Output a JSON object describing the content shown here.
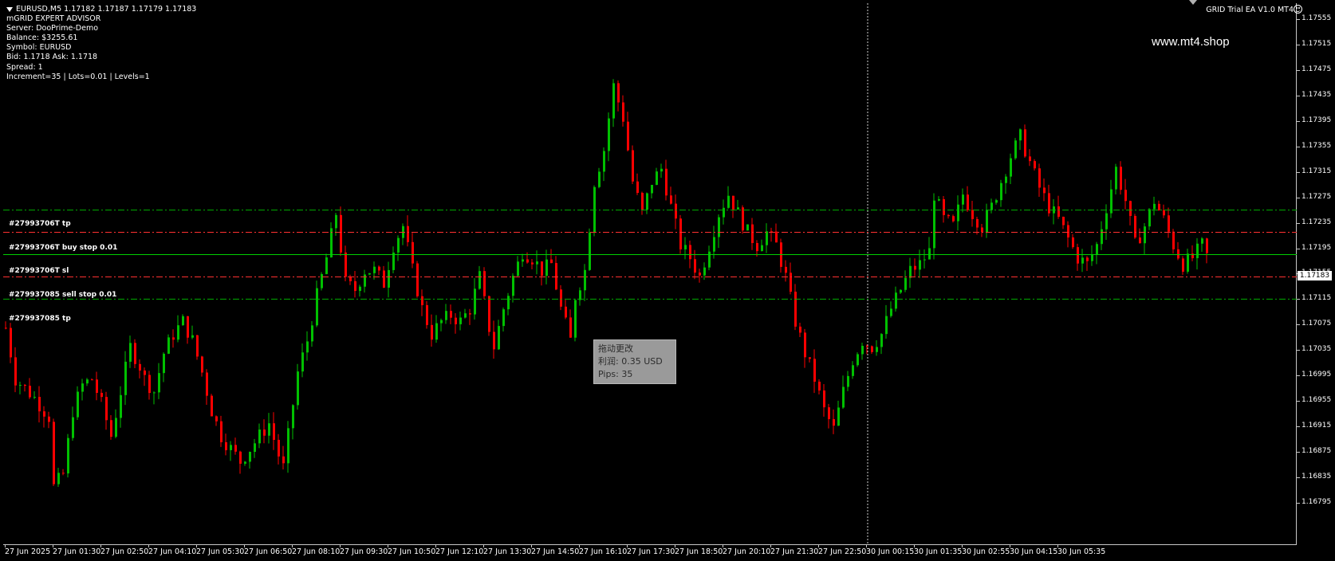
{
  "chart_header": {
    "symbol_line": "EURUSD,M5  1.17182 1.17187 1.17179 1.17183",
    "info_lines": [
      "mGRID EXPERT ADVISOR",
      "Server: DooPrime-Demo",
      "Balance: $3255.61",
      "Symbol: EURUSD",
      "Bid: 1.1718 Ask: 1.1718",
      "Spread: 1",
      "Increment=35 | Lots=0.01 | Levels=1"
    ]
  },
  "ea_title": "GRID Trial EA  V1.0 MT4",
  "icons": {
    "smiley": "smiley-face-icon",
    "dropdown": "dropdown-triangle-icon"
  },
  "watermark": "www.mt4.shop",
  "current_price": "1.17183",
  "order_lines": [
    {
      "label": "#27993706T  tp",
      "price": 1.17255,
      "color": "#00b000",
      "style": "dashdot"
    },
    {
      "label": "#27993706T  buy stop 0.01",
      "price": 1.1722,
      "color": "#ff3030",
      "style": "dashdot"
    },
    {
      "label": "#27993706T  sl",
      "price": 1.17185,
      "color": "#00d000",
      "style": "solid"
    },
    {
      "label": "#279937085  sell stop 0.01",
      "price": 1.1715,
      "color": "#ff3030",
      "style": "dashdot"
    },
    {
      "label": "#279937085  tp",
      "price": 1.17115,
      "color": "#00b000",
      "style": "dashdot"
    }
  ],
  "tooltip": {
    "title": "拖动更改",
    "profit": "利润:   0.35 USD",
    "pips": "Pips:  35"
  },
  "colors": {
    "background": "#000000",
    "bull_candle": "#00c000",
    "bear_candle": "#ff0000",
    "buy_line": "#ff3030",
    "tp_line": "#00b000",
    "sl_line": "#00d000"
  },
  "chart_data": {
    "type": "candlestick",
    "symbol": "EURUSD",
    "timeframe": "M5",
    "y_ticks": [
      "1.17555",
      "1.17515",
      "1.17475",
      "1.17435",
      "1.17395",
      "1.17355",
      "1.17315",
      "1.17275",
      "1.17235",
      "1.17195",
      "1.17155",
      "1.17115",
      "1.17075",
      "1.17035",
      "1.16995",
      "1.16955",
      "1.16915",
      "1.16875",
      "1.16835",
      "1.16795"
    ],
    "ylim": [
      1.16795,
      1.17555
    ],
    "x_ticks": [
      "27 Jun 2025",
      "27 Jun 01:30",
      "27 Jun 02:50",
      "27 Jun 04:10",
      "27 Jun 05:30",
      "27 Jun 06:50",
      "27 Jun 08:10",
      "27 Jun 09:30",
      "27 Jun 10:50",
      "27 Jun 12:10",
      "27 Jun 13:30",
      "27 Jun 14:50",
      "27 Jun 16:10",
      "27 Jun 17:30",
      "27 Jun 18:50",
      "27 Jun 20:10",
      "27 Jun 21:30",
      "27 Jun 22:50",
      "30 Jun 00:15",
      "30 Jun 01:35",
      "30 Jun 02:55",
      "30 Jun 04:15",
      "30 Jun 05:35"
    ],
    "period_separator_after": "27 Jun 22:50",
    "price_path": [
      [
        0,
        1.1707
      ],
      [
        2,
        1.1699
      ],
      [
        6,
        1.1696
      ],
      [
        9,
        1.1693
      ],
      [
        10,
        1.1682
      ],
      [
        12,
        1.1684
      ],
      [
        14,
        1.1694
      ],
      [
        16,
        1.1698
      ],
      [
        18,
        1.1699
      ],
      [
        20,
        1.1695
      ],
      [
        22,
        1.169
      ],
      [
        24,
        1.1697
      ],
      [
        26,
        1.1704
      ],
      [
        28,
        1.1701
      ],
      [
        29,
        1.1699
      ],
      [
        31,
        1.1697
      ],
      [
        33,
        1.1703
      ],
      [
        35,
        1.1706
      ],
      [
        37,
        1.1708
      ],
      [
        39,
        1.1705
      ],
      [
        41,
        1.17
      ],
      [
        43,
        1.1694
      ],
      [
        45,
        1.169
      ],
      [
        47,
        1.1688
      ],
      [
        49,
        1.1686
      ],
      [
        51,
        1.1688
      ],
      [
        53,
        1.169
      ],
      [
        55,
        1.1692
      ],
      [
        57,
        1.1687
      ],
      [
        58,
        1.1685
      ],
      [
        59,
        1.169
      ],
      [
        61,
        1.17
      ],
      [
        63,
        1.1705
      ],
      [
        65,
        1.1712
      ],
      [
        67,
        1.1718
      ],
      [
        69,
        1.1725
      ],
      [
        71,
        1.1714
      ],
      [
        73,
        1.1713
      ],
      [
        75,
        1.1716
      ],
      [
        77,
        1.1716
      ],
      [
        79,
        1.1714
      ],
      [
        81,
        1.172
      ],
      [
        83,
        1.1723
      ],
      [
        85,
        1.1716
      ],
      [
        87,
        1.171
      ],
      [
        89,
        1.1706
      ],
      [
        91,
        1.1708
      ],
      [
        93,
        1.1709
      ],
      [
        95,
        1.1708
      ],
      [
        97,
        1.171
      ],
      [
        99,
        1.1715
      ],
      [
        101,
        1.1707
      ],
      [
        102,
        1.1704
      ],
      [
        104,
        1.171
      ],
      [
        106,
        1.1715
      ],
      [
        108,
        1.1719
      ],
      [
        110,
        1.1718
      ],
      [
        112,
        1.1716
      ],
      [
        114,
        1.1717
      ],
      [
        116,
        1.171
      ],
      [
        118,
        1.1705
      ],
      [
        119,
        1.1712
      ],
      [
        121,
        1.1716
      ],
      [
        123,
        1.173
      ],
      [
        125,
        1.1735
      ],
      [
        127,
        1.1745
      ],
      [
        129,
        1.174
      ],
      [
        131,
        1.173
      ],
      [
        133,
        1.1725
      ],
      [
        135,
        1.173
      ],
      [
        137,
        1.1732
      ],
      [
        139,
        1.1726
      ],
      [
        141,
        1.172
      ],
      [
        143,
        1.1718
      ],
      [
        145,
        1.1715
      ],
      [
        147,
        1.172
      ],
      [
        149,
        1.1725
      ],
      [
        151,
        1.1728
      ],
      [
        153,
        1.1725
      ],
      [
        155,
        1.1722
      ],
      [
        157,
        1.172
      ],
      [
        159,
        1.1722
      ],
      [
        161,
        1.172
      ],
      [
        163,
        1.1715
      ],
      [
        165,
        1.1708
      ],
      [
        167,
        1.1703
      ],
      [
        169,
        1.1699
      ],
      [
        171,
        1.1694
      ],
      [
        173,
        1.1691
      ],
      [
        175,
        1.1697
      ],
      [
        177,
        1.1702
      ],
      [
        179,
        1.1705
      ],
      [
        181,
        1.1704
      ],
      [
        183,
        1.1706
      ],
      [
        185,
        1.171
      ],
      [
        187,
        1.1713
      ],
      [
        189,
        1.1716
      ],
      [
        191,
        1.1717
      ],
      [
        193,
        1.1719
      ],
      [
        194,
        1.1728
      ],
      [
        196,
        1.1724
      ],
      [
        198,
        1.1723
      ],
      [
        200,
        1.1728
      ],
      [
        202,
        1.1725
      ],
      [
        204,
        1.1723
      ],
      [
        206,
        1.1726
      ],
      [
        208,
        1.173
      ],
      [
        210,
        1.1734
      ],
      [
        212,
        1.1737
      ],
      [
        214,
        1.1733
      ],
      [
        216,
        1.1729
      ],
      [
        218,
        1.1726
      ],
      [
        220,
        1.1724
      ],
      [
        222,
        1.1721
      ],
      [
        224,
        1.1718
      ],
      [
        226,
        1.1717
      ],
      [
        228,
        1.172
      ],
      [
        230,
        1.1726
      ],
      [
        232,
        1.1732
      ],
      [
        234,
        1.1727
      ],
      [
        236,
        1.172
      ],
      [
        238,
        1.1723
      ],
      [
        240,
        1.1727
      ],
      [
        242,
        1.1724
      ],
      [
        244,
        1.172
      ],
      [
        246,
        1.1717
      ],
      [
        248,
        1.1718
      ],
      [
        250,
        1.172
      ],
      [
        251,
        1.17183
      ]
    ]
  }
}
